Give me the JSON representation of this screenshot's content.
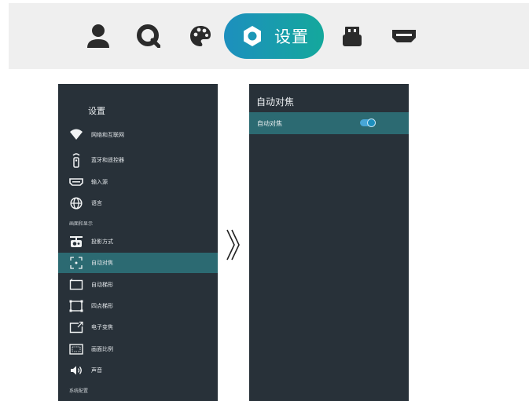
{
  "topnav": {
    "items": [
      {
        "icon": "person-icon"
      },
      {
        "icon": "search-icon"
      },
      {
        "icon": "palette-icon"
      },
      {
        "icon": "settings-icon",
        "label": "设置",
        "active": true
      },
      {
        "icon": "usb-icon"
      },
      {
        "icon": "hdmi-icon"
      }
    ],
    "active_gradient": [
      "#1d8fbe",
      "#14a89c"
    ]
  },
  "settings_menu": {
    "title": "设置",
    "items": [
      {
        "label": "网络和互联网",
        "icon": "wifi-icon"
      },
      {
        "label": "蓝牙和遥控器",
        "icon": "remote-icon"
      },
      {
        "label": "输入源",
        "icon": "input-source-icon"
      },
      {
        "label": "语言",
        "icon": "globe-icon"
      }
    ],
    "section_display": "画面和显示",
    "display_items": [
      {
        "label": "投影方式",
        "icon": "projector-icon"
      },
      {
        "label": "自动对焦",
        "icon": "autofocus-icon",
        "selected": true
      },
      {
        "label": "自动梯形",
        "icon": "auto-keystone-icon"
      },
      {
        "label": "四点梯形",
        "icon": "four-point-keystone-icon"
      },
      {
        "label": "电子变焦",
        "icon": "digital-zoom-icon"
      },
      {
        "label": "画面比例",
        "icon": "aspect-ratio-icon"
      },
      {
        "label": "声音",
        "icon": "speaker-icon"
      }
    ],
    "section_system": "系统配置"
  },
  "arrow": {
    "glyph": "》"
  },
  "detail_panel": {
    "title": "自动对焦",
    "row_label": "自动对焦",
    "toggle_on": true
  },
  "colors": {
    "panel_bg": "#283139",
    "selected_bg": "#2c6a72",
    "accent": "#48a6d6"
  }
}
